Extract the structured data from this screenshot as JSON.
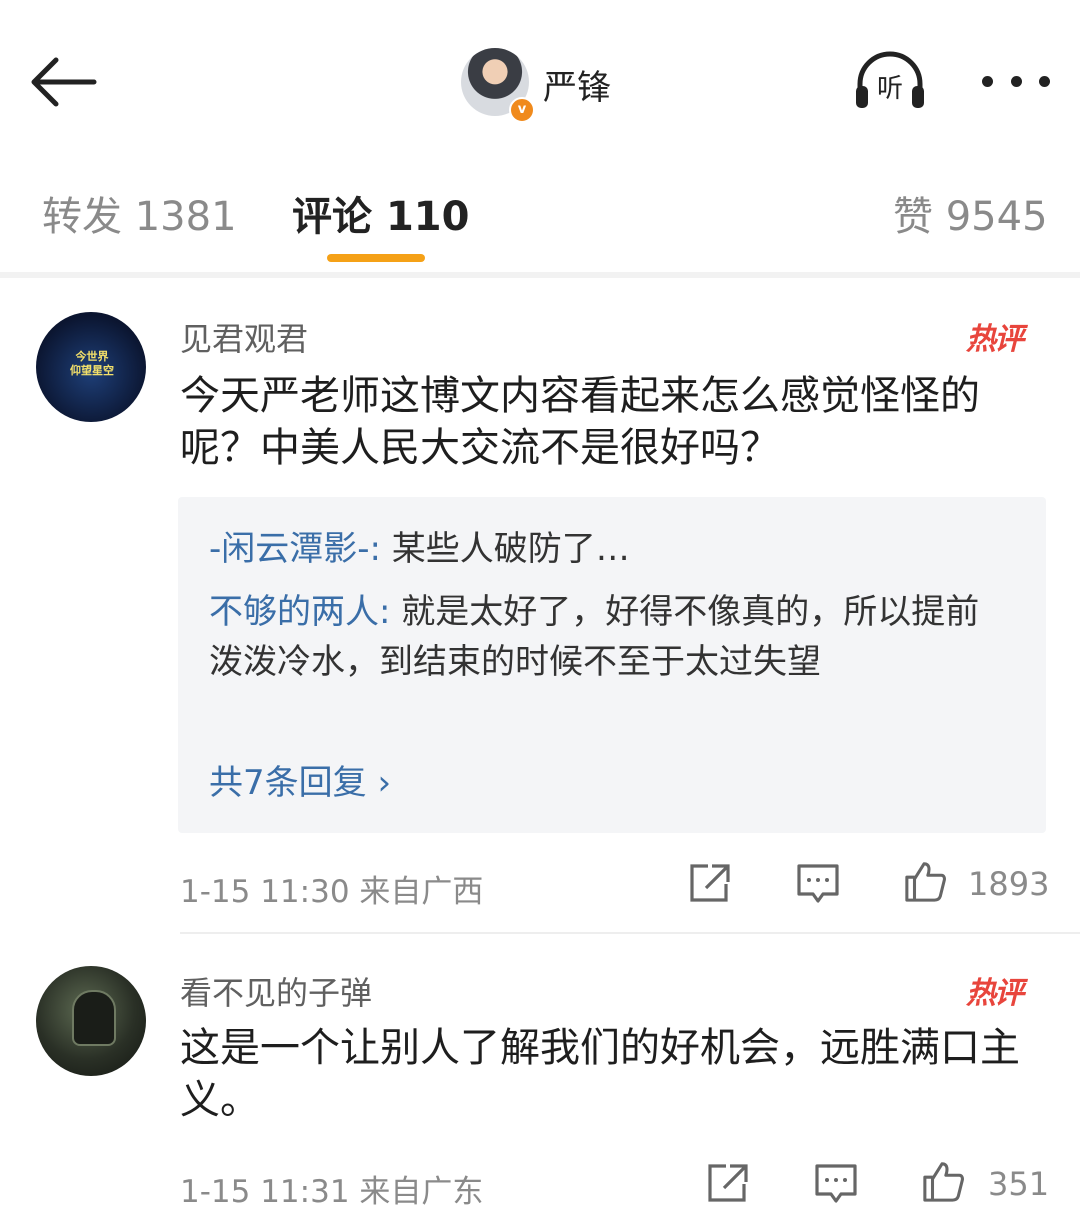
{
  "header": {
    "author": "严锋",
    "badge": "v",
    "listen_label": "听"
  },
  "tabs": [
    {
      "label": "转发",
      "count": "1381"
    },
    {
      "label": "评论",
      "count": "110"
    },
    {
      "label": "赞",
      "count": "9545"
    }
  ],
  "comments": [
    {
      "username": "见君观君",
      "hot_label": "热评",
      "text": "今天严老师这博文内容看起来怎么感觉怪怪的呢？中美人民大交流不是很好吗？",
      "replies": [
        {
          "user": "-闲云潭影-:",
          "text": " 某些人破防了…"
        },
        {
          "user": "不够的两人:",
          "text": " 就是太好了，好得不像真的，所以提前泼泼冷水，到结束的时候不至于太过失望"
        }
      ],
      "more_replies": "共7条回复 ›",
      "time": "1-15 11:30",
      "location": "来自广西",
      "likes": "1893",
      "avatar_text": [
        "今世界",
        "仰望星空"
      ]
    },
    {
      "username": "看不见的子弹",
      "hot_label": "热评",
      "text": "这是一个让别人了解我们的好机会，远胜满口主义。",
      "time": "1-15 11:31",
      "location": "来自广东",
      "likes": "351"
    }
  ],
  "colors": {
    "accent": "#f5a117",
    "link": "#3a6ea8",
    "hot": "#e8453c"
  }
}
